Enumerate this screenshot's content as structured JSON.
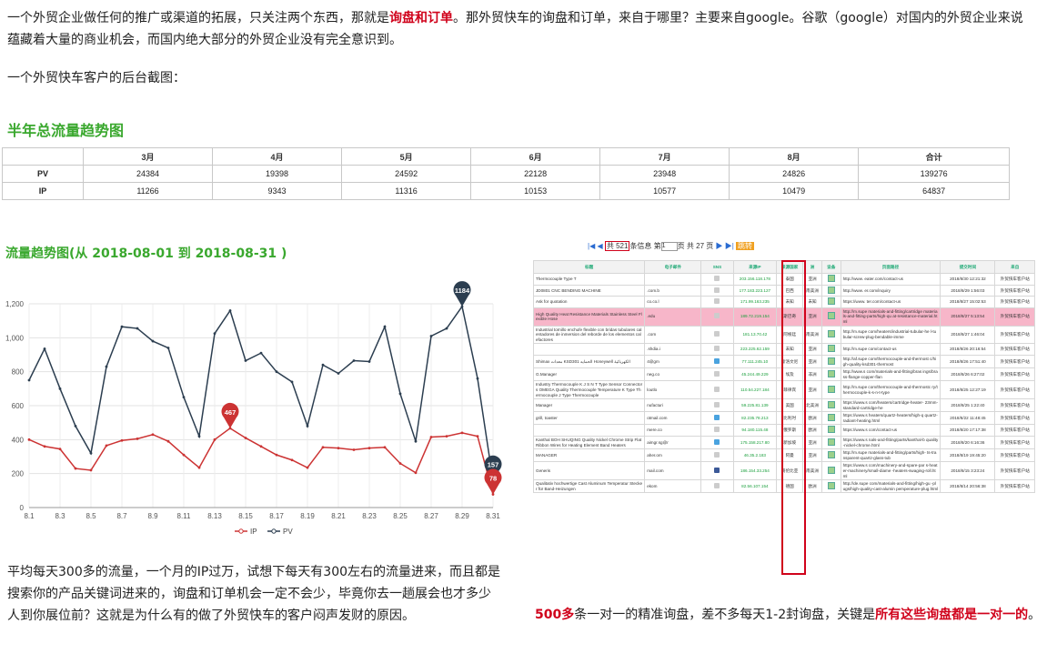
{
  "intro": {
    "line1_a": "一个外贸企业做任何的推广或渠道的拓展，只关注两个东西，那就是",
    "line1_hl": "询盘和订单",
    "line1_b": "。那外贸快车的询盘和订单，来自于哪里？主要来自google。谷歌（google）对国内的外贸企业来说",
    "line2": "蕴藏着大量的商业机会，而国内绝大部分的外贸企业没有完全意识到。",
    "line3": "一个外贸快车客户的后台截图："
  },
  "half_year": {
    "title": "半年总流量趋势图",
    "headers": [
      "",
      "3月",
      "4月",
      "5月",
      "6月",
      "7月",
      "8月",
      "合计"
    ],
    "rows": [
      {
        "label": "PV",
        "values": [
          "24384",
          "19398",
          "24592",
          "22128",
          "23948",
          "24826",
          "139276"
        ]
      },
      {
        "label": "IP",
        "values": [
          "11266",
          "9343",
          "11316",
          "10153",
          "10577",
          "10479",
          "64837"
        ]
      }
    ]
  },
  "trend_title": "流量趋势图(从 2018-08-01 到 2018-08-31 )",
  "chart_data": {
    "type": "line",
    "x": [
      "8.1",
      "8.2",
      "8.3",
      "8.4",
      "8.5",
      "8.6",
      "8.7",
      "8.8",
      "8.9",
      "8.10",
      "8.11",
      "8.12",
      "8.13",
      "8.14",
      "8.15",
      "8.16",
      "8.17",
      "8.18",
      "8.19",
      "8.20",
      "8.21",
      "8.22",
      "8.23",
      "8.24",
      "8.25",
      "8.26",
      "8.27",
      "8.28",
      "8.29",
      "8.30",
      "8.31"
    ],
    "x_tick_labels": [
      "8.1",
      "8.3",
      "8.5",
      "8.7",
      "8.9",
      "8.11",
      "8.13",
      "8.15",
      "8.17",
      "8.19",
      "8.21",
      "8.23",
      "8.25",
      "8.27",
      "8.29",
      "8.31"
    ],
    "y_ticks": [
      "0",
      "200",
      "400",
      "600",
      "800",
      "1,000",
      "1,200"
    ],
    "ylim": [
      0,
      1200
    ],
    "series": [
      {
        "name": "IP",
        "color": "#cc3333",
        "values": [
          400,
          360,
          345,
          230,
          220,
          365,
          395,
          405,
          430,
          390,
          310,
          235,
          400,
          467,
          410,
          360,
          310,
          280,
          235,
          355,
          350,
          340,
          350,
          355,
          260,
          205,
          415,
          420,
          440,
          420,
          78
        ]
      },
      {
        "name": "PV",
        "color": "#2c3e50",
        "values": [
          750,
          935,
          700,
          480,
          320,
          830,
          1065,
          1055,
          980,
          940,
          650,
          420,
          1025,
          1160,
          865,
          910,
          800,
          740,
          480,
          840,
          790,
          865,
          860,
          1065,
          670,
          390,
          1010,
          1055,
          1184,
          760,
          157
        ]
      }
    ],
    "pins": [
      {
        "series": "PV",
        "index": 28,
        "label": "1184"
      },
      {
        "series": "IP",
        "index": 13,
        "label": "467"
      },
      {
        "series": "PV",
        "index": 30,
        "label": "157"
      },
      {
        "series": "IP",
        "index": 30,
        "label": "78"
      }
    ],
    "legend_position": "bottom-center"
  },
  "bottom_left": {
    "line1": "平均每天300多的流量，一个月的IP过万，试想下每天有300左右的流量进来，而且都是",
    "line2": "搜索你的产品关键词进来的，询盘和订单机会一定不会少，毕竟你去一趟展会也才多少",
    "line3": "人到你展位前？这就是为什么有的做了外贸快车的客户闷声发财的原因。"
  },
  "bottom_right": {
    "num": "500多",
    "text_a": "条一对一的精准询盘，差不多每天1-2封询盘，关键是",
    "text_hl": "所有这些询盘都是一对一的",
    "text_b": "。"
  },
  "inquiry": {
    "pager": {
      "first": "|◀",
      "prev": "◀",
      "total": "共 521",
      "items_label": "条信息 第",
      "page": "1",
      "pages": "页 共 27 页",
      "next": "▶",
      "last": "▶|",
      "go": "跳转"
    },
    "headers": [
      "标题",
      "电子邮件",
      "SNS",
      "来源IP",
      "来源国家",
      "洲",
      "设备",
      "页面路径",
      "提交时间",
      "来自"
    ],
    "rows": [
      {
        "title": "Thermocouple Type T",
        "email": "                     ",
        "ip": "203.156.118.178",
        "country": "泰国",
        "cont": "亚洲",
        "path": "http://www.          eater.com/contact-us",
        "time": "2018/8/30 12:21:32",
        "from": "外贸快车客户站"
      },
      {
        "title": "JD0801 CNC BENDING MACHINE",
        "email": "          .com.b",
        "ip": "177.183.223.127",
        "country": "巴西",
        "cont": "南美洲",
        "path": "http://www.          er.com/inquiry",
        "time": "2018/8/29 1:56:03",
        "from": "外贸快车客户站"
      },
      {
        "title": "Ask for quotation",
        "email": "          co.co.l",
        "ip": "171.99.163.235",
        "country": "未知",
        "cont": "未知",
        "path": "https://www.        ter.com/contact-us",
        "time": "2018/8/27 15:02:53",
        "from": "外贸快车客户站"
      },
      {
        "title": "High Quality Heat Resistance Materials Stainless Steel Flexible Hose",
        "email": "          .edu",
        "ip": "189.72.219.154",
        "country": "斯巴奇",
        "cont": "亚洲",
        "path": "http://m.supe         materials-and-fitting/cartridge         materials-and-fitting-parts/high-qu   at-resistance-material.html",
        "time": "2018/8/27 5:13:54",
        "from": "外贸快车客户站",
        "pink": true
      },
      {
        "title": "Industrial tornillo enchufe flexible con bridas tubulares calentadores de inmersion del reborde de los elementos calefactores",
        "email": "          .com",
        "ip": "181.13.70.42",
        "country": "阿根廷",
        "cont": "南美洲",
        "path": "http://m.supe          com/heaters/industrial-tubular-he   l-tubular-screw-plug-bendable-imme",
        "time": "2018/8/27 1:46:04",
        "from": "外贸快车客户站"
      },
      {
        "title": "",
        "email": "          .shdia.i",
        "ip": "223.225.62.159",
        "country": "未知",
        "cont": "亚洲",
        "path": "http://m.supe         com/contact-us",
        "time": "2018/8/26 20:16:54",
        "from": "外贸快车客户站"
      },
      {
        "title": "Shimax معدات KSD301 الحمايه Honeywell الكهربائية",
        "email": "          4@gm",
        "ip": "77.111.245.10",
        "country": "斯洛文尼",
        "cont": "亚洲",
        "path": "http://af.supe         com/thermocouple-and-thermost   c/high-quality-ksd301-thermost",
        "time": "2018/8/26 17:51:40",
        "from": "外贸快车客户站"
      },
      {
        "title": "G.Manager",
        "email": "          neg.co",
        "ip": "45.244.49.229",
        "country": "埃及",
        "cont": "非洲",
        "path": "http://www.s         com/materials-and-fitting/bras     ings/brass-flange-copper-flan",
        "time": "2018/8/26 6:27:02",
        "from": "外贸快车客户站"
      },
      {
        "title": "Industry Thermocouple K J S N T Type Sensor Connectors OMEGA Quality Thermocouple Temperature K Type Thermocouple J Type Thermocouple",
        "email": "          loutlo",
        "ip": "110.54.227.184",
        "country": "菲律宾",
        "cont": "亚洲",
        "path": "http://m.supe         com/thermocouple-and-thermostc   ry/thermocouple-k-s-n-t-type",
        "time": "2018/8/25 12:27:19",
        "from": "外贸快车客户站"
      },
      {
        "title": "Manager",
        "email": "          nufacturi",
        "ip": "59.225.81.139",
        "country": "美国",
        "cont": "北美洲",
        "path": "https://www.s         com/heaters/cartridge-heater-   23mm-standard-cartridge-he",
        "time": "2018/8/25 1:22:40",
        "from": "外贸快车客户站"
      },
      {
        "title": "grill, toaster",
        "email": "          otmail.com",
        "ip": "82.235.78.213",
        "country": "比利时",
        "cont": "欧洲",
        "path": "https://www.s         heaters/quartz-heaters/high-q   quartz-radiant-heating.html",
        "time": "2018/8/22 11:48:45",
        "from": "外贸快车客户站"
      },
      {
        "title": "",
        "email": "          mere.co",
        "ip": "94.180.115.48",
        "country": "俄罗斯",
        "cont": "欧洲",
        "path": "https://www.s         com/contact-us",
        "time": "2018/8/20 17:17:38",
        "from": "外贸快车客户站"
      },
      {
        "title": "Kanthal BOH SHUQING Quality Nickel Chrome Strip Flat Ribbon Wires for Heating Element Band Heaters",
        "email": "          aimgr.sg@r",
        "ip": "175.158.217.80",
        "country": "新加坡",
        "cont": "亚洲",
        "path": "https://www.s         nals-and-fitting/parts/kanthal-b   quality-nickel-chrome.html",
        "time": "2018/8/20 6:16:36",
        "from": "外贸快车客户站"
      },
      {
        "title": "MANAGER",
        "email": "          aher.om",
        "ip": "46.35.2.183",
        "country": "阿曼",
        "cont": "亚洲",
        "path": "http://m.supe         materials-and-fitting/parts/high-     ts-transparent-quartz-glass-tub",
        "time": "2018/8/19 19:45:20",
        "from": "外贸快车客户站"
      },
      {
        "title": "Generis",
        "email": "          mail.com",
        "ip": "186.154.33.254",
        "country": "哥伦比亚",
        "cont": "南美洲",
        "path": "https://www.s         com/machinery-and-spare-par    s-heater-machinery/small-diame    -heaters-swaging-roll.html",
        "time": "2018/8/15 3:23:24",
        "from": "外贸快车客户站"
      },
      {
        "title": "Qualitativ hochwertige Cast Aluminum Temperatur Stecker für Band-Heizungen",
        "email": "          ekom",
        "ip": "82.56.107.154",
        "country": "德国",
        "cont": "欧洲",
        "path": "http://de.supe         com/materials-and-fitting/high-gu    -plugs/high-quality-cast-alumin    pemperature-plug.html",
        "time": "2018/8/14 20:56:38",
        "from": "外贸快车客户站"
      }
    ]
  }
}
